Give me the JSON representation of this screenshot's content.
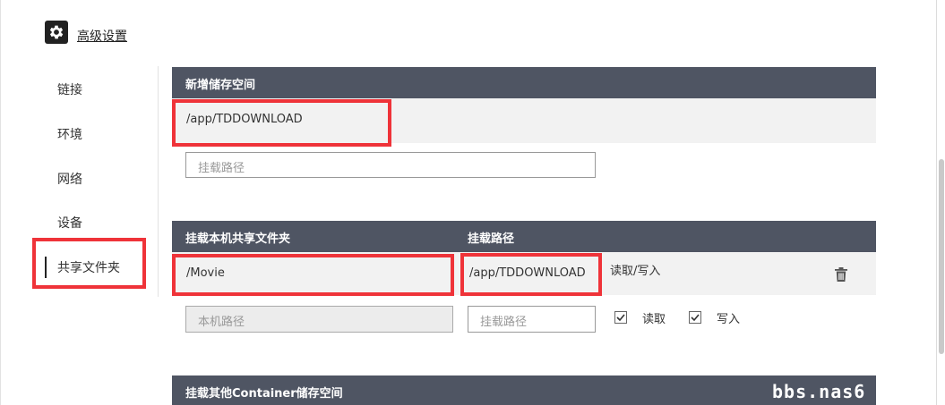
{
  "header": {
    "title": "高级设置",
    "icon": "gear-icon"
  },
  "sidebar": {
    "items": [
      {
        "label": "链接"
      },
      {
        "label": "环境"
      },
      {
        "label": "网络"
      },
      {
        "label": "设备"
      },
      {
        "label": "共享文件夹",
        "active": true
      }
    ]
  },
  "storage": {
    "title": "新增储存空间",
    "existing_path": "/app/TDDOWNLOAD",
    "placeholder": "挂载路径"
  },
  "share": {
    "col_host": "挂载本机共享文件夹",
    "col_mount": "挂载路径",
    "row": {
      "host": "/Movie",
      "mount": "/app/TDDOWNLOAD",
      "permission": "读取/写入"
    },
    "new_host_placeholder": "本机路径",
    "new_mount_placeholder": "挂载路径",
    "read_label": "读取",
    "write_label": "写入",
    "read_checked": true,
    "write_checked": true
  },
  "container": {
    "title": "挂载其他Container储存空间"
  },
  "watermark": "bbs.nas6",
  "colors": {
    "header_bg": "#4f5563",
    "highlight": "#ef3339",
    "row_bg": "#f2f2f2"
  }
}
